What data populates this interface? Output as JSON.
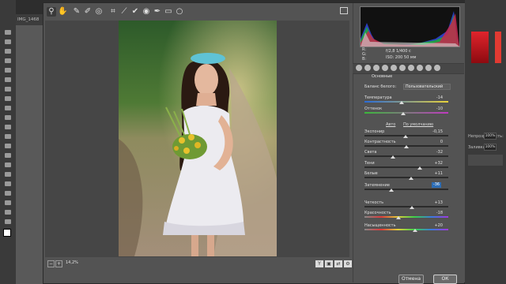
{
  "ps": {
    "doc_tab": "IMG_1468",
    "right_labels": [
      "Непрозрачность:",
      "Заливка:"
    ],
    "right_values": [
      "100%",
      "100%"
    ]
  },
  "camera_raw": {
    "camera_info": {
      "r": "R:",
      "g": "G:",
      "b": "B:",
      "aperture_shutter": "f/2,8  1/400 с",
      "iso_focal": "ISO: 200  50 мм"
    },
    "section_title": "Основные",
    "white_balance": {
      "label": "Баланс белого:",
      "value": "Пользовательский"
    },
    "links": {
      "auto": "Авто",
      "default": "По умолчанию"
    },
    "sliders": [
      {
        "id": "temperature",
        "label": "Температура",
        "value": "-14",
        "fraction": 0.44
      },
      {
        "id": "tint",
        "label": "Оттенок",
        "value": "-10",
        "fraction": 0.46
      },
      {
        "id": "exposure",
        "label": "Экспонир",
        "value": "-0,15",
        "fraction": 0.49
      },
      {
        "id": "contrast",
        "label": "Контрастность",
        "value": "0",
        "fraction": 0.5
      },
      {
        "id": "highlights",
        "label": "Света",
        "value": "-32",
        "fraction": 0.34
      },
      {
        "id": "shadows",
        "label": "Тени",
        "value": "+32",
        "fraction": 0.66
      },
      {
        "id": "whites",
        "label": "Белые",
        "value": "+11",
        "fraction": 0.555
      },
      {
        "id": "blacks",
        "label": "Затемнение",
        "value": "-36",
        "fraction": 0.32
      },
      {
        "id": "clarity",
        "label": "Четкость",
        "value": "+13",
        "fraction": 0.565
      },
      {
        "id": "vibrance",
        "label": "Красочность",
        "value": "-18",
        "fraction": 0.41
      },
      {
        "id": "saturation",
        "label": "Насыщенность",
        "value": "+20",
        "fraction": 0.6
      }
    ],
    "zoom": "14,2%",
    "buttons": {
      "cancel": "Отмена",
      "ok": "ОК"
    }
  }
}
